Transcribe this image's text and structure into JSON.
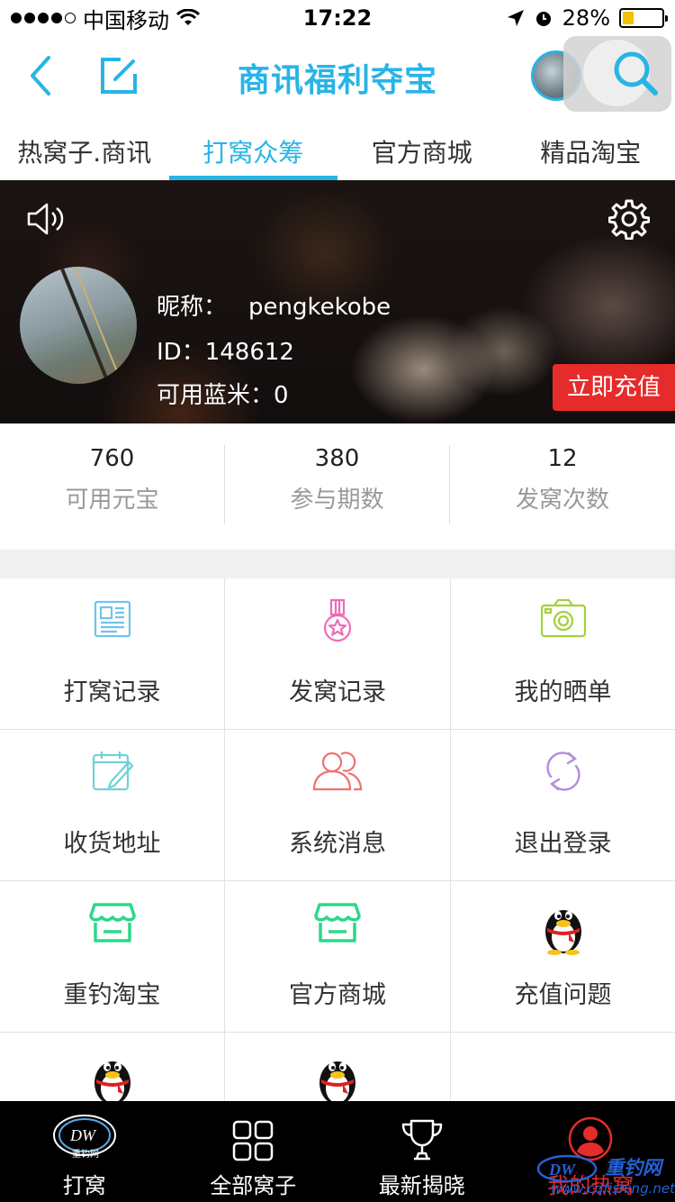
{
  "status_bar": {
    "carrier": "中国移动",
    "time": "17:22",
    "battery_percent": "28%",
    "battery_level": 0.28
  },
  "nav": {
    "title": "商讯福利夺宝"
  },
  "tabs": [
    {
      "label": "热窝子.商讯",
      "active": false
    },
    {
      "label": "打窝众筹",
      "active": true
    },
    {
      "label": "官方商城",
      "active": false
    },
    {
      "label": "精品淘宝",
      "active": false
    }
  ],
  "profile": {
    "nickname_label": "昵称：",
    "nickname": "pengkekobe",
    "id_text": "ID：148612",
    "blue_rice_text": "可用蓝米：0",
    "recharge_label": "立即充值"
  },
  "stats": [
    {
      "value": "760",
      "label": "可用元宝"
    },
    {
      "value": "380",
      "label": "参与期数"
    },
    {
      "value": "12",
      "label": "发窝次数"
    }
  ],
  "grid": [
    {
      "label": "打窝记录",
      "icon": "document-icon"
    },
    {
      "label": "发窝记录",
      "icon": "medal-icon"
    },
    {
      "label": "我的晒单",
      "icon": "camera-icon"
    },
    {
      "label": "收货地址",
      "icon": "notepad-icon"
    },
    {
      "label": "系统消息",
      "icon": "users-icon"
    },
    {
      "label": "退出登录",
      "icon": "refresh-icon"
    },
    {
      "label": "重钓淘宝",
      "icon": "store-icon"
    },
    {
      "label": "官方商城",
      "icon": "store-icon"
    },
    {
      "label": "充值问题",
      "icon": "qq-penguin-icon"
    },
    {
      "label": "",
      "icon": "qq-penguin-icon"
    },
    {
      "label": "",
      "icon": "qq-penguin-icon"
    },
    {
      "label": "",
      "icon": ""
    }
  ],
  "bottom_nav": [
    {
      "label": "打窝",
      "icon": "dw-logo-icon"
    },
    {
      "label": "全部窝子",
      "icon": "grid-icon"
    },
    {
      "label": "最新揭晓",
      "icon": "trophy-icon"
    },
    {
      "label": "我的热窝",
      "icon": "user-profile-icon",
      "active": true
    }
  ],
  "watermark": {
    "title": "重钓网",
    "url": "www.cqfishing.net"
  },
  "colors": {
    "accent": "#28b4e6",
    "recharge": "#e62b2b",
    "document": "#6fc3ee",
    "medal": "#f06ab8",
    "camera": "#a4d13a",
    "notepad": "#6fd1d8",
    "users": "#f07070",
    "refresh": "#b08ce0",
    "store": "#2bd88a"
  }
}
